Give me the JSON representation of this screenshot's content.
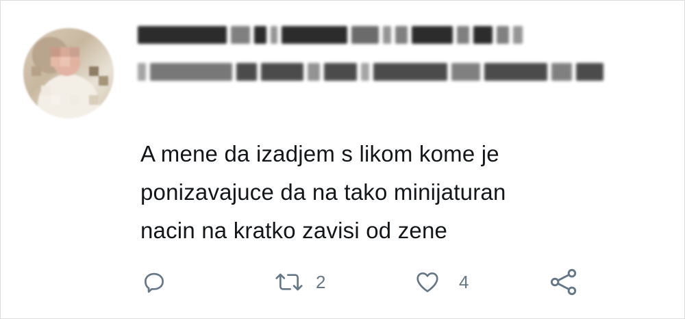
{
  "tweet": {
    "author_name": "",
    "author_handle": "",
    "reply_context": "",
    "text_lines": [
      "A mene da izadjem s likom kome je",
      "ponizavajuce da na tako minijaturan",
      "nacin na kratko zavisi od zene"
    ]
  },
  "actions": {
    "reply": {
      "icon": "reply-icon",
      "count": ""
    },
    "retweet": {
      "icon": "retweet-icon",
      "count": "2"
    },
    "like": {
      "icon": "heart-icon",
      "count": "4"
    },
    "share": {
      "icon": "share-icon",
      "count": ""
    }
  },
  "colors": {
    "text": "#14171a",
    "icon": "#657786",
    "background": "#ffffff"
  }
}
